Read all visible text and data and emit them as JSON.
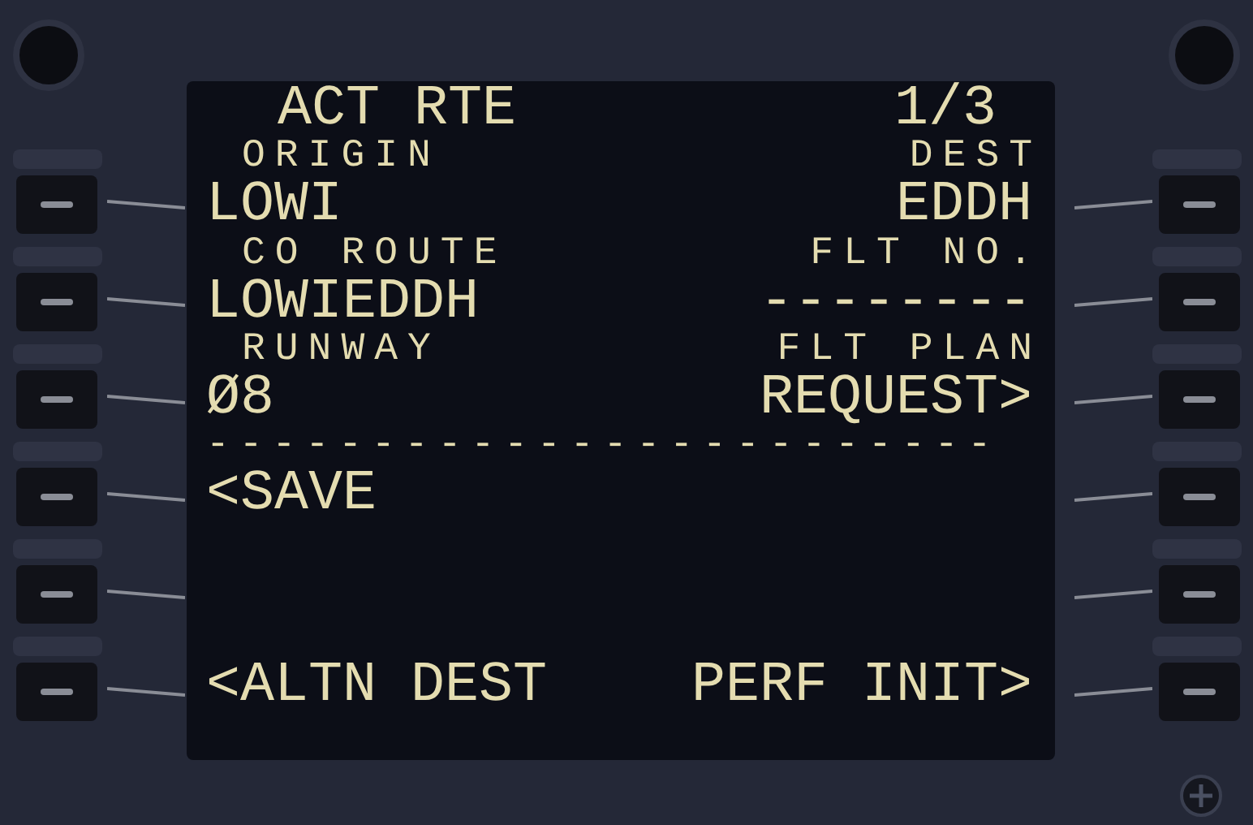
{
  "screen": {
    "title": "ACT RTE",
    "page": "1/3",
    "rows": [
      {
        "label_left": "ORIGIN",
        "label_right": "DEST",
        "left": "LOWI",
        "right": "EDDH"
      },
      {
        "label_left": "CO ROUTE",
        "label_right": "FLT NO.",
        "left": "LOWIEDDH",
        "right": "--------"
      },
      {
        "label_left": "RUNWAY",
        "label_right": "FLT PLAN",
        "left": "Ø8",
        "right": "REQUEST>"
      },
      {
        "label_left": "------------------------",
        "left": "<SAVE"
      },
      {},
      {
        "left": "<ALTN DEST",
        "right": "PERF INIT>"
      }
    ]
  }
}
